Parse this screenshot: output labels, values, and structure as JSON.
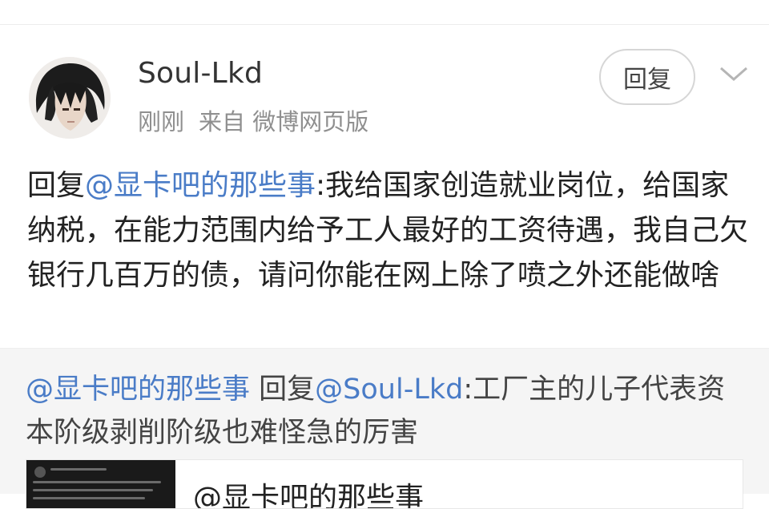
{
  "post": {
    "author": "Soul-Lkd",
    "time": "刚刚",
    "source": "来自 微博网页版",
    "reply_button": "回复",
    "text_prefix": "回复",
    "mention": "@显卡吧的那些事",
    "text_body": ":我给国家创造就业岗位，给国家纳税，在能力范围内给予工人最好的工资待遇，我自己欠银行几百万的债，请问你能在网上除了喷之外还能做啥"
  },
  "quoted": {
    "author_mention": "@显卡吧的那些事",
    "reply_word": " 回复",
    "reply_mention": "@Soul-Lkd",
    "text": ":工厂主的儿子代表资本阶级剥削阶级也难怪急的厉害",
    "card_title": "@显卡吧的那些事"
  },
  "icons": {
    "avatar": "user-avatar",
    "chevron": "chevron-down-icon"
  }
}
